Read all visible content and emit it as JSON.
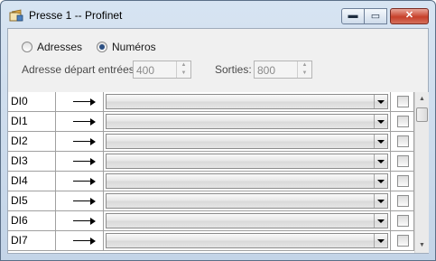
{
  "window": {
    "title": "Presse 1 -- Profinet",
    "minimize_glyph": "▬",
    "maximize_glyph": "▭",
    "close_glyph": "✕"
  },
  "mode": {
    "options": [
      "Adresses",
      "Numéros"
    ],
    "selected": "Numéros"
  },
  "addresses": {
    "inputs_label": "Adresse départ entrées:",
    "inputs_value": "400",
    "outputs_label": "Sorties:",
    "outputs_value": "800"
  },
  "rows": [
    {
      "name": "DI0",
      "selection": "",
      "checked": false
    },
    {
      "name": "DI1",
      "selection": "",
      "checked": false
    },
    {
      "name": "DI2",
      "selection": "",
      "checked": false
    },
    {
      "name": "DI3",
      "selection": "",
      "checked": false
    },
    {
      "name": "DI4",
      "selection": "",
      "checked": false
    },
    {
      "name": "DI5",
      "selection": "",
      "checked": false
    },
    {
      "name": "DI6",
      "selection": "",
      "checked": false
    },
    {
      "name": "DI7",
      "selection": "",
      "checked": false
    }
  ],
  "icons": [
    "app-icon",
    "arrow-right-icon",
    "chevron-down-icon",
    "scroll-up-icon",
    "scroll-down-icon"
  ]
}
